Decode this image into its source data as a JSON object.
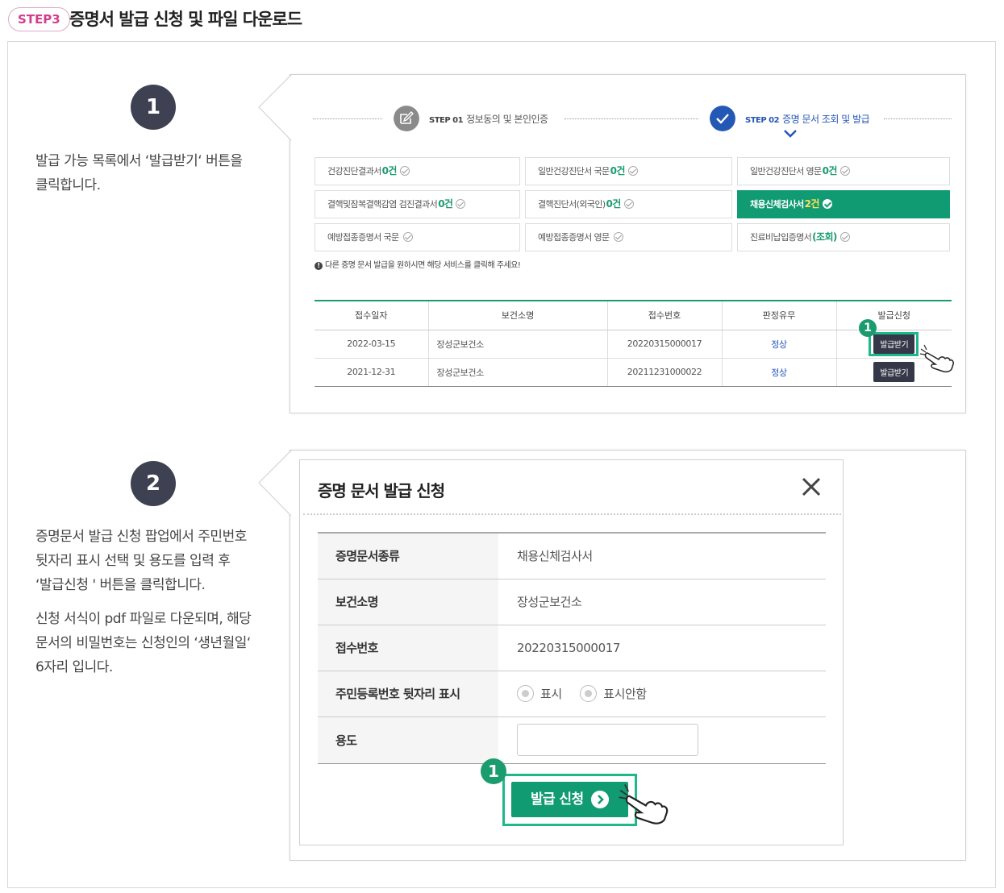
{
  "header": {
    "step_badge": "STEP3",
    "title": "증명서 발급 신청 및 파일 다운로드"
  },
  "steps": [
    {
      "number": "1",
      "desc_lines": [
        "발급 가능 목록에서 ‘발급받기‘ 버튼을",
        "클릭합니다."
      ]
    },
    {
      "number": "2",
      "desc_lines": [
        "증명문서 발급 신청 팝업에서 주민번호",
        "뒷자리 표시 선택 및 용도를 입력 후",
        "‘발급신청 ' 버튼을 클릭합니다.",
        "신청 서식이 pdf 파일로 다운되며, 해당",
        "문서의 비밀번호는 신청인의 ‘생년월일‘",
        "6자리 입니다."
      ]
    }
  ],
  "panel1": {
    "nav": [
      {
        "step": "STEP 01",
        "label": "정보동의 및 본인인증",
        "active": false
      },
      {
        "step": "STEP 02",
        "label": "증명 문서 조회 및 발급",
        "active": true
      }
    ],
    "certificates": [
      {
        "name": "건강진단결과서",
        "count": "0건",
        "active": false
      },
      {
        "name": "일반건강진단서 국문",
        "count": "0건",
        "active": false
      },
      {
        "name": "일반건강진단서 영문",
        "count": "0건",
        "active": false
      },
      {
        "name": "결핵및잠복결핵감염 검진결과서",
        "count": "0건",
        "active": false
      },
      {
        "name": "결핵진단서(외국인)",
        "count": "0건",
        "active": false
      },
      {
        "name": "채용신체검사서",
        "count": "2건",
        "active": true
      },
      {
        "name": "예방접종증명서 국문",
        "count": "",
        "active": false
      },
      {
        "name": "예방접종증명서 영문",
        "count": "",
        "active": false
      },
      {
        "name": "진료비납입증명서",
        "count": "(조회)",
        "active": false
      }
    ],
    "notice": "다른 증명 문서 발급을 원하시면 해당 서비스를 클릭해 주세요!",
    "table": {
      "headers": [
        "접수일자",
        "보건소명",
        "접수번호",
        "판정유무",
        "발급신청"
      ],
      "rows": [
        [
          "2022-03-15",
          "장성군보건소",
          "20220315000017",
          "정상",
          "발급받기"
        ],
        [
          "2021-12-31",
          "장성군보건소",
          "20211231000022",
          "정상",
          "발급받기"
        ]
      ]
    },
    "callout": "1"
  },
  "panel2": {
    "title": "증명 문서 발급 신청",
    "fields": [
      {
        "label": "증명문서종류",
        "value": "채용신체검사서"
      },
      {
        "label": "보건소명",
        "value": "장성군보건소"
      },
      {
        "label": "접수번호",
        "value": "20220315000017"
      },
      {
        "label": "주민등록번호 뒷자리 표시",
        "value": ""
      },
      {
        "label": "용도",
        "value": ""
      }
    ],
    "radio_options": [
      "표시",
      "표시안함"
    ],
    "submit_label": "발급 신청",
    "callout": "1"
  }
}
